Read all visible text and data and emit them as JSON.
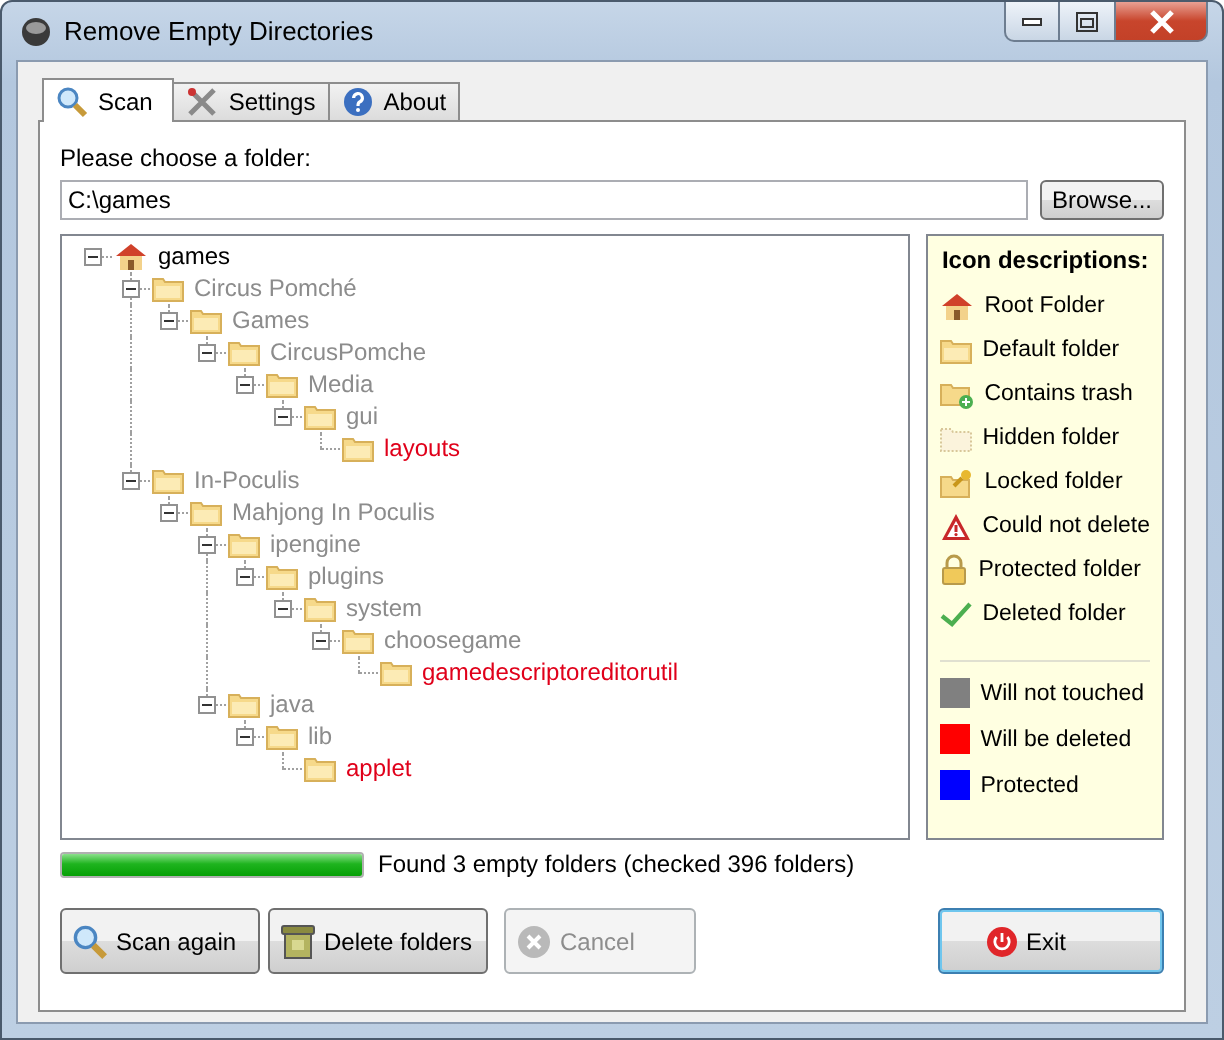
{
  "window": {
    "title": "Remove Empty Directories"
  },
  "tabs": [
    {
      "label": "Scan",
      "kind": "search",
      "selected": true
    },
    {
      "label": "Settings",
      "kind": "tools",
      "selected": false
    },
    {
      "label": "About",
      "kind": "help",
      "selected": false
    }
  ],
  "folder": {
    "label": "Please choose a folder:",
    "value": "C:\\games",
    "browse": "Browse..."
  },
  "tree": [
    {
      "name": "games",
      "kind": "root",
      "color": "#000000",
      "expanded": true,
      "children": [
        {
          "name": "Circus Pomché",
          "kind": "folder",
          "color": "#8c8c8c",
          "expanded": true,
          "children": [
            {
              "name": "Games",
              "kind": "folder",
              "color": "#8c8c8c",
              "expanded": true,
              "children": [
                {
                  "name": "CircusPomche",
                  "kind": "folder",
                  "color": "#8c8c8c",
                  "expanded": true,
                  "children": [
                    {
                      "name": "Media",
                      "kind": "folder",
                      "color": "#8c8c8c",
                      "expanded": true,
                      "children": [
                        {
                          "name": "gui",
                          "kind": "folder",
                          "color": "#8c8c8c",
                          "expanded": true,
                          "children": [
                            {
                              "name": "layouts",
                              "kind": "folder",
                              "color": "#e0001a"
                            }
                          ]
                        }
                      ]
                    }
                  ]
                }
              ]
            }
          ]
        },
        {
          "name": "In-Poculis",
          "kind": "folder",
          "color": "#8c8c8c",
          "expanded": true,
          "children": [
            {
              "name": "Mahjong In Poculis",
              "kind": "folder",
              "color": "#8c8c8c",
              "expanded": true,
              "children": [
                {
                  "name": "ipengine",
                  "kind": "folder",
                  "color": "#8c8c8c",
                  "expanded": true,
                  "children": [
                    {
                      "name": "plugins",
                      "kind": "folder",
                      "color": "#8c8c8c",
                      "expanded": true,
                      "children": [
                        {
                          "name": "system",
                          "kind": "folder",
                          "color": "#8c8c8c",
                          "expanded": true,
                          "children": [
                            {
                              "name": "choosegame",
                              "kind": "folder",
                              "color": "#8c8c8c",
                              "expanded": true,
                              "children": [
                                {
                                  "name": "gamedescriptoreditorutil",
                                  "kind": "folder",
                                  "color": "#e0001a"
                                }
                              ]
                            }
                          ]
                        }
                      ]
                    }
                  ]
                },
                {
                  "name": "java",
                  "kind": "folder",
                  "color": "#8c8c8c",
                  "expanded": true,
                  "children": [
                    {
                      "name": "lib",
                      "kind": "folder",
                      "color": "#8c8c8c",
                      "expanded": true,
                      "children": [
                        {
                          "name": "applet",
                          "kind": "folder",
                          "color": "#e0001a"
                        }
                      ]
                    }
                  ]
                }
              ]
            }
          ]
        }
      ]
    }
  ],
  "legend": {
    "title": "Icon descriptions:",
    "icons": [
      {
        "label": "Root Folder",
        "kind": "root"
      },
      {
        "label": "Default folder",
        "kind": "default"
      },
      {
        "label": "Contains trash",
        "kind": "trash"
      },
      {
        "label": "Hidden folder",
        "kind": "hidden"
      },
      {
        "label": "Locked folder",
        "kind": "locked"
      },
      {
        "label": "Could not delete",
        "kind": "error"
      },
      {
        "label": "Protected folder",
        "kind": "protected"
      },
      {
        "label": "Deleted folder",
        "kind": "deleted"
      }
    ],
    "colors": [
      {
        "label": "Will not touched",
        "color": "#808080"
      },
      {
        "label": "Will be deleted",
        "color": "#ff0000"
      },
      {
        "label": "Protected",
        "color": "#0000ff"
      }
    ]
  },
  "progress": {
    "level": 1,
    "text": "Found 3 empty folders (checked 396 folders)"
  },
  "buttons": [
    {
      "label": "Scan again",
      "kind": "search",
      "disabled": false,
      "focused": false
    },
    {
      "label": "Delete folders",
      "kind": "bin",
      "disabled": false,
      "focused": false
    },
    {
      "label": "Cancel",
      "kind": "cancel",
      "disabled": true,
      "focused": false
    },
    {
      "label": "Exit",
      "kind": "power",
      "disabled": false,
      "focused": true
    }
  ]
}
